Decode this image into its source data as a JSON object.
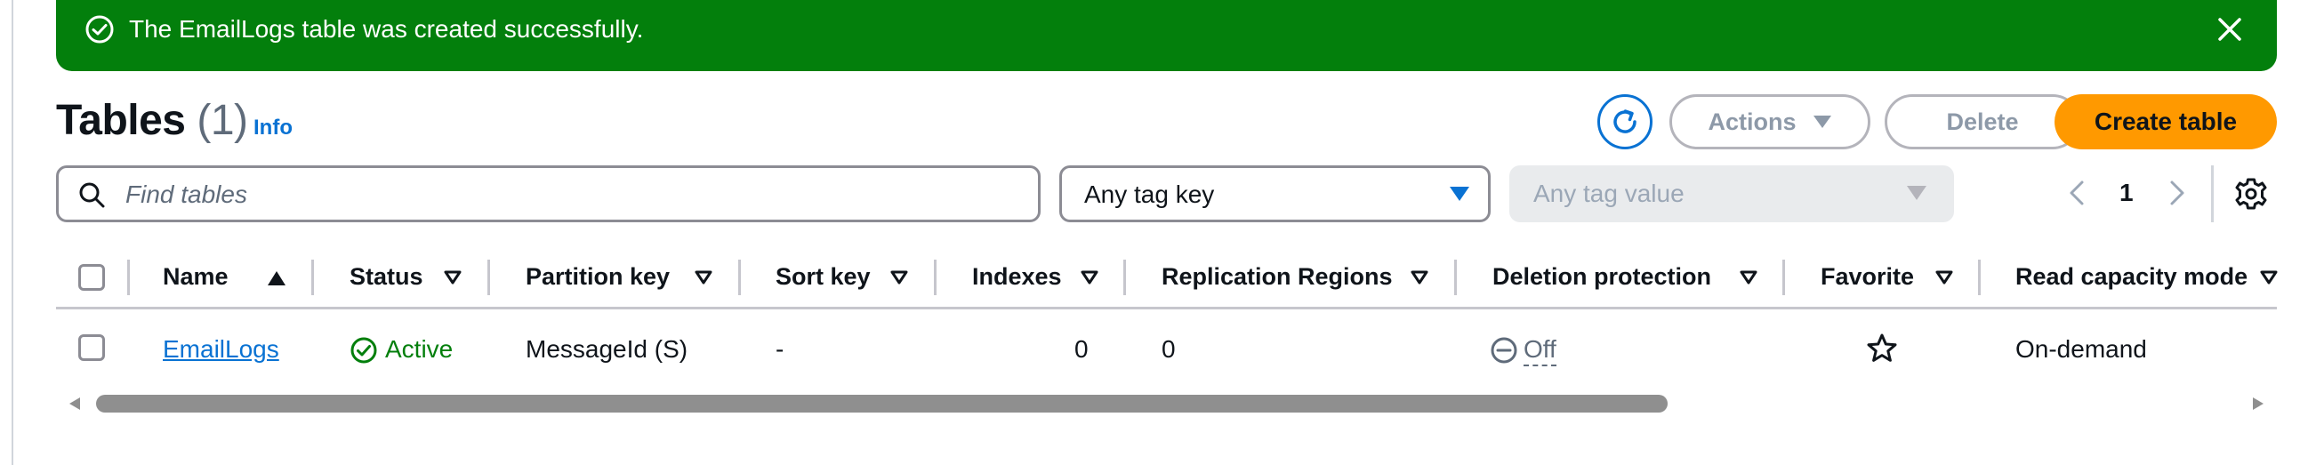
{
  "flash": {
    "message": "The EmailLogs table was created successfully.",
    "color": "#037f0c"
  },
  "header": {
    "title": "Tables",
    "count": "(1)",
    "info_label": "Info"
  },
  "actions": {
    "refresh_icon": "refresh-icon",
    "actions_label": "Actions",
    "delete_label": "Delete",
    "create_label": "Create table",
    "primary_color": "#ff9900"
  },
  "filters": {
    "search_placeholder": "Find tables",
    "tag_key_value": "Any tag key",
    "tag_value_placeholder": "Any tag value"
  },
  "pagination": {
    "current_page": "1"
  },
  "table": {
    "columns": [
      "Name",
      "Status",
      "Partition key",
      "Sort key",
      "Indexes",
      "Replication Regions",
      "Deletion protection",
      "Favorite",
      "Read capacity mode"
    ],
    "rows": [
      {
        "name": "EmailLogs",
        "status": "Active",
        "partition_key": "MessageId (S)",
        "sort_key": "-",
        "indexes": "0",
        "replication_regions": "0",
        "deletion_protection": "Off",
        "favorite": "star-outline-icon",
        "read_capacity_mode": "On-demand"
      }
    ]
  }
}
